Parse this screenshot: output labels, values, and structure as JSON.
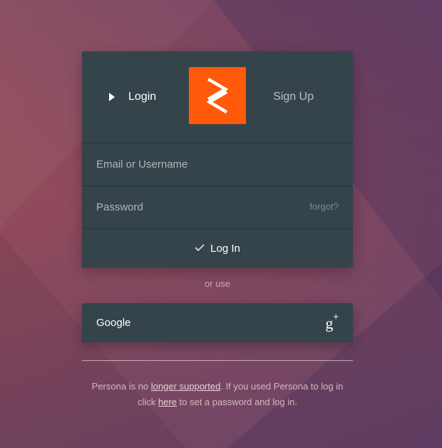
{
  "tabs": {
    "login_label": "Login",
    "signup_label": "Sign Up"
  },
  "form": {
    "email_placeholder": "Email or Username",
    "email_value": "",
    "password_placeholder": "Password",
    "password_value": "",
    "forgot_label": "forgot?",
    "submit_label": "Log In"
  },
  "alt": {
    "or_use": "or use",
    "google_label": "Google",
    "google_icon": "google-plus-icon"
  },
  "notice": {
    "part1": "Persona is no ",
    "link1": "longer supported",
    "part2": ". If you used Persona to log in click ",
    "link2": "here",
    "part3": " to set a password and log in."
  },
  "colors": {
    "accent": "#ff5a0a",
    "card": "#35434a"
  }
}
